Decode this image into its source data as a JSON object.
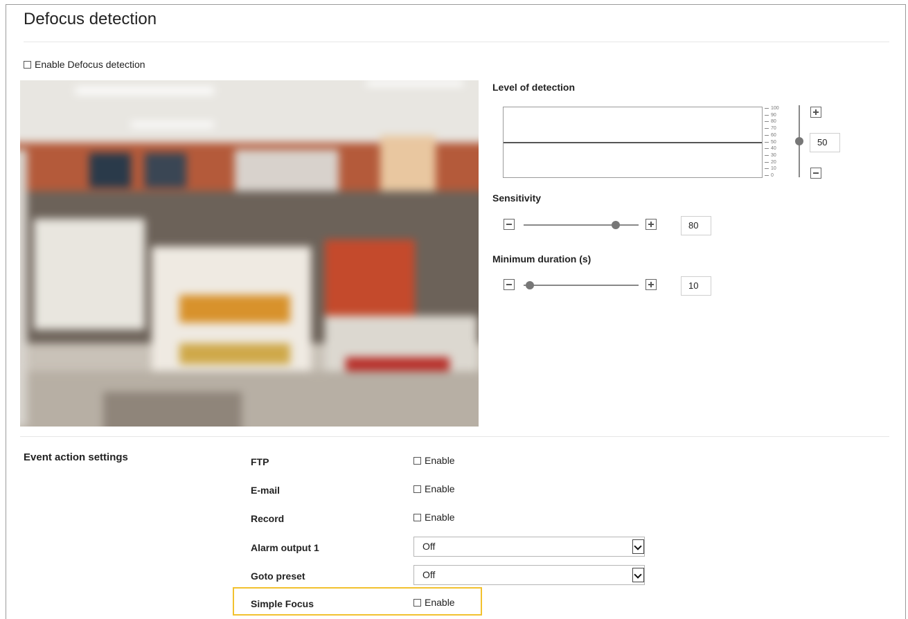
{
  "page": {
    "title": "Defocus detection"
  },
  "enable_defocus": {
    "label": "Enable Defocus detection",
    "checked": false
  },
  "level_of_detection": {
    "label": "Level of detection",
    "value": "50",
    "scale_max": 100,
    "ticks": [
      "100",
      "90",
      "80",
      "70",
      "60",
      "50",
      "40",
      "30",
      "20",
      "10",
      "0"
    ]
  },
  "sensitivity": {
    "label": "Sensitivity",
    "value": "80",
    "min": 0,
    "max": 100
  },
  "minimum_duration": {
    "label": "Minimum duration (s)",
    "value": "10",
    "min": 5,
    "max": 100
  },
  "event_action": {
    "title": "Event action settings",
    "ftp": {
      "label": "FTP",
      "option": "Enable",
      "checked": false
    },
    "email": {
      "label": "E-mail",
      "option": "Enable",
      "checked": false
    },
    "record": {
      "label": "Record",
      "option": "Enable",
      "checked": false
    },
    "alarm_output": {
      "label": "Alarm output 1",
      "value": "Off"
    },
    "goto_preset": {
      "label": "Goto preset",
      "value": "Off"
    },
    "simple_focus": {
      "label": "Simple Focus",
      "option": "Enable",
      "checked": false
    }
  },
  "colors": {
    "highlight": "#f2c12e",
    "text": "#222222",
    "track": "#888888"
  }
}
